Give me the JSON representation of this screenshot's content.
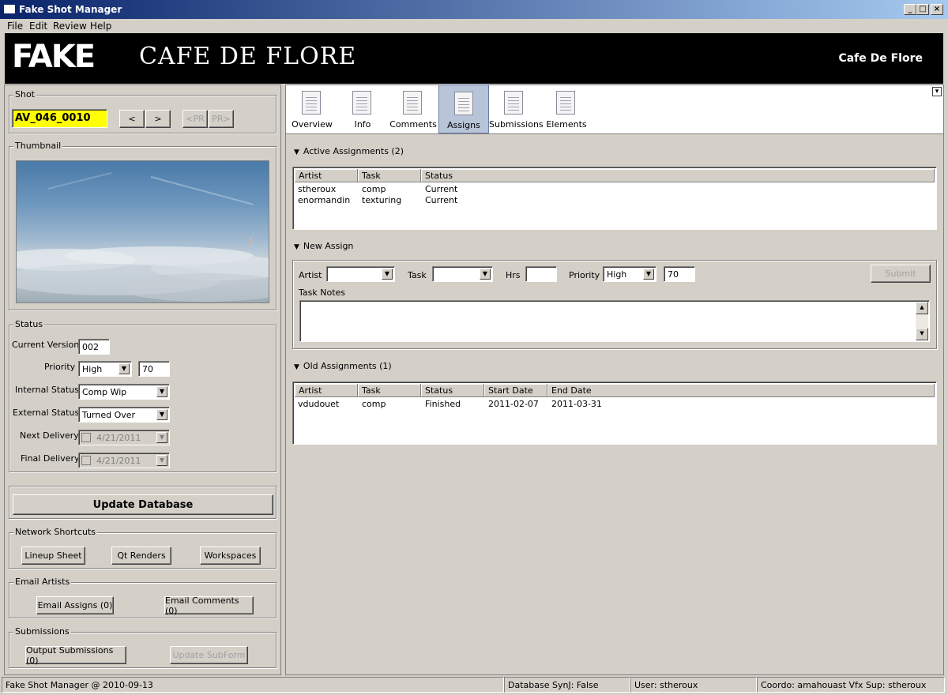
{
  "window": {
    "title": "Fake Shot Manager"
  },
  "menu": [
    "File",
    "Edit",
    "Review",
    "Help"
  ],
  "banner": {
    "logo": "FAKE",
    "title": "CAFE DE FLORE",
    "right": "Cafe De Flore"
  },
  "shot": {
    "group_label": "Shot",
    "code": "AV_046_0010",
    "prev": "<",
    "next": ">",
    "prev_pr": "<PR",
    "next_pr": "PR>"
  },
  "thumbnail": {
    "group_label": "Thumbnail"
  },
  "status": {
    "group_label": "Status",
    "current_version_label": "Current Version",
    "current_version": "002",
    "priority_label": "Priority",
    "priority": "High",
    "priority_value": "70",
    "internal_status_label": "Internal Status",
    "internal_status": "Comp Wip",
    "external_status_label": "External Status",
    "external_status": "Turned Over",
    "next_delivery_label": "Next Delivery",
    "next_delivery": "4/21/2011",
    "final_delivery_label": "Final Delivery",
    "final_delivery": "4/21/2011"
  },
  "update_database": "Update Database",
  "network_shortcuts": {
    "group_label": "Network Shortcuts",
    "lineup": "Lineup Sheet",
    "qt_renders": "Qt Renders",
    "workspaces": "Workspaces"
  },
  "email_artists": {
    "group_label": "Email Artists",
    "assigns": "Email Assigns (0)",
    "comments": "Email Comments (0)"
  },
  "submissions": {
    "group_label": "Submissions",
    "output": "Output Submissions (0)",
    "update_subform": "Update SubForm"
  },
  "tabs": [
    {
      "label": "Overview"
    },
    {
      "label": "Info"
    },
    {
      "label": "Comments"
    },
    {
      "label": "Assigns",
      "active": true
    },
    {
      "label": "Submissions"
    },
    {
      "label": "Elements"
    }
  ],
  "active_assignments": {
    "title": "Active Assignments (2)",
    "columns": [
      "Artist",
      "Task",
      "Status"
    ],
    "rows": [
      [
        "stheroux",
        "comp",
        "Current"
      ],
      [
        "enormandin",
        "texturing",
        "Current"
      ]
    ]
  },
  "new_assign": {
    "title": "New Assign",
    "artist_label": "Artist",
    "artist": "",
    "task_label": "Task",
    "task": "",
    "hrs_label": "Hrs",
    "hrs": "",
    "priority_label": "Priority",
    "priority": "High",
    "priority_value": "70",
    "submit": "Submit",
    "notes_label": "Task Notes",
    "notes": ""
  },
  "old_assignments": {
    "title": "Old Assignments (1)",
    "columns": [
      "Artist",
      "Task",
      "Status",
      "Start Date",
      "End Date"
    ],
    "rows": [
      [
        "vdudouet",
        "comp",
        "Finished",
        "2011-02-07",
        "2011-03-31"
      ]
    ]
  },
  "statusbar": {
    "app": "Fake Shot Manager @ 2010-09-13",
    "sync": "Database SynJ: False",
    "user": "User: stheroux",
    "coordo": "Coordo: amahouast  Vfx Sup: stheroux"
  },
  "colors": {
    "shot_field": "#ffff00",
    "active_tab": "#b8c4d8",
    "title_bar": "#0a246a"
  }
}
